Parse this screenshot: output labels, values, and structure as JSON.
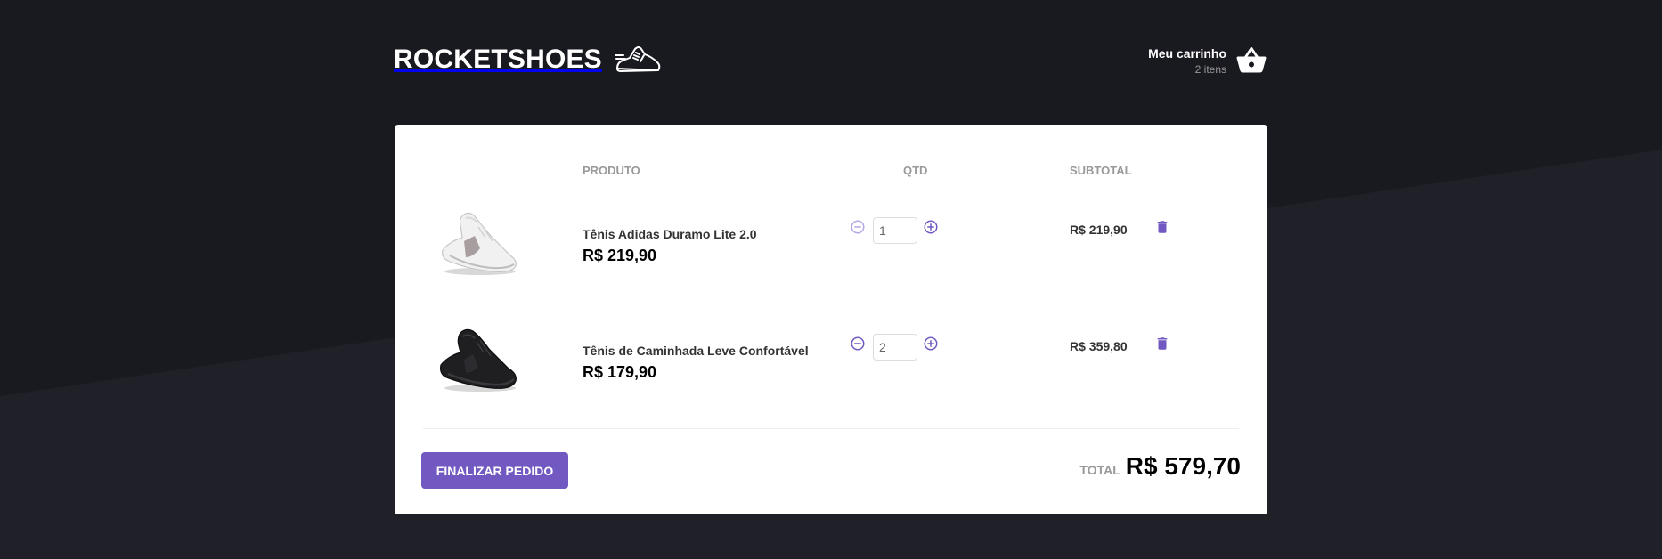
{
  "brand": {
    "name": "ROCKETSHOES"
  },
  "cart_header": {
    "title": "Meu carrinho",
    "count": "2 itens"
  },
  "table": {
    "headers": {
      "product": "PRODUTO",
      "qty": "QTD",
      "subtotal": "SUBTOTAL"
    },
    "items": [
      {
        "title": "Tênis Adidas Duramo Lite 2.0",
        "price": "R$ 219,90",
        "qty": "1",
        "subtotal": "R$ 219,90",
        "image": "white-sneaker",
        "minus_enabled": false
      },
      {
        "title": "Tênis de Caminhada Leve Confortável",
        "price": "R$ 179,90",
        "qty": "2",
        "subtotal": "R$ 359,80",
        "image": "black-sneaker",
        "minus_enabled": true
      }
    ]
  },
  "footer": {
    "checkout_label": "FINALIZAR PEDIDO",
    "total_label": "TOTAL",
    "total_value": "R$ 579,70"
  },
  "colors": {
    "accent": "#7159c1",
    "background": "#191920",
    "panel": "#ffffff",
    "disabled": "#b5a7e6"
  },
  "icons": {
    "logo": "sneaker-icon",
    "cart": "basket-icon",
    "minus": "remove-circle-icon",
    "plus": "add-circle-icon",
    "delete": "trash-icon"
  }
}
